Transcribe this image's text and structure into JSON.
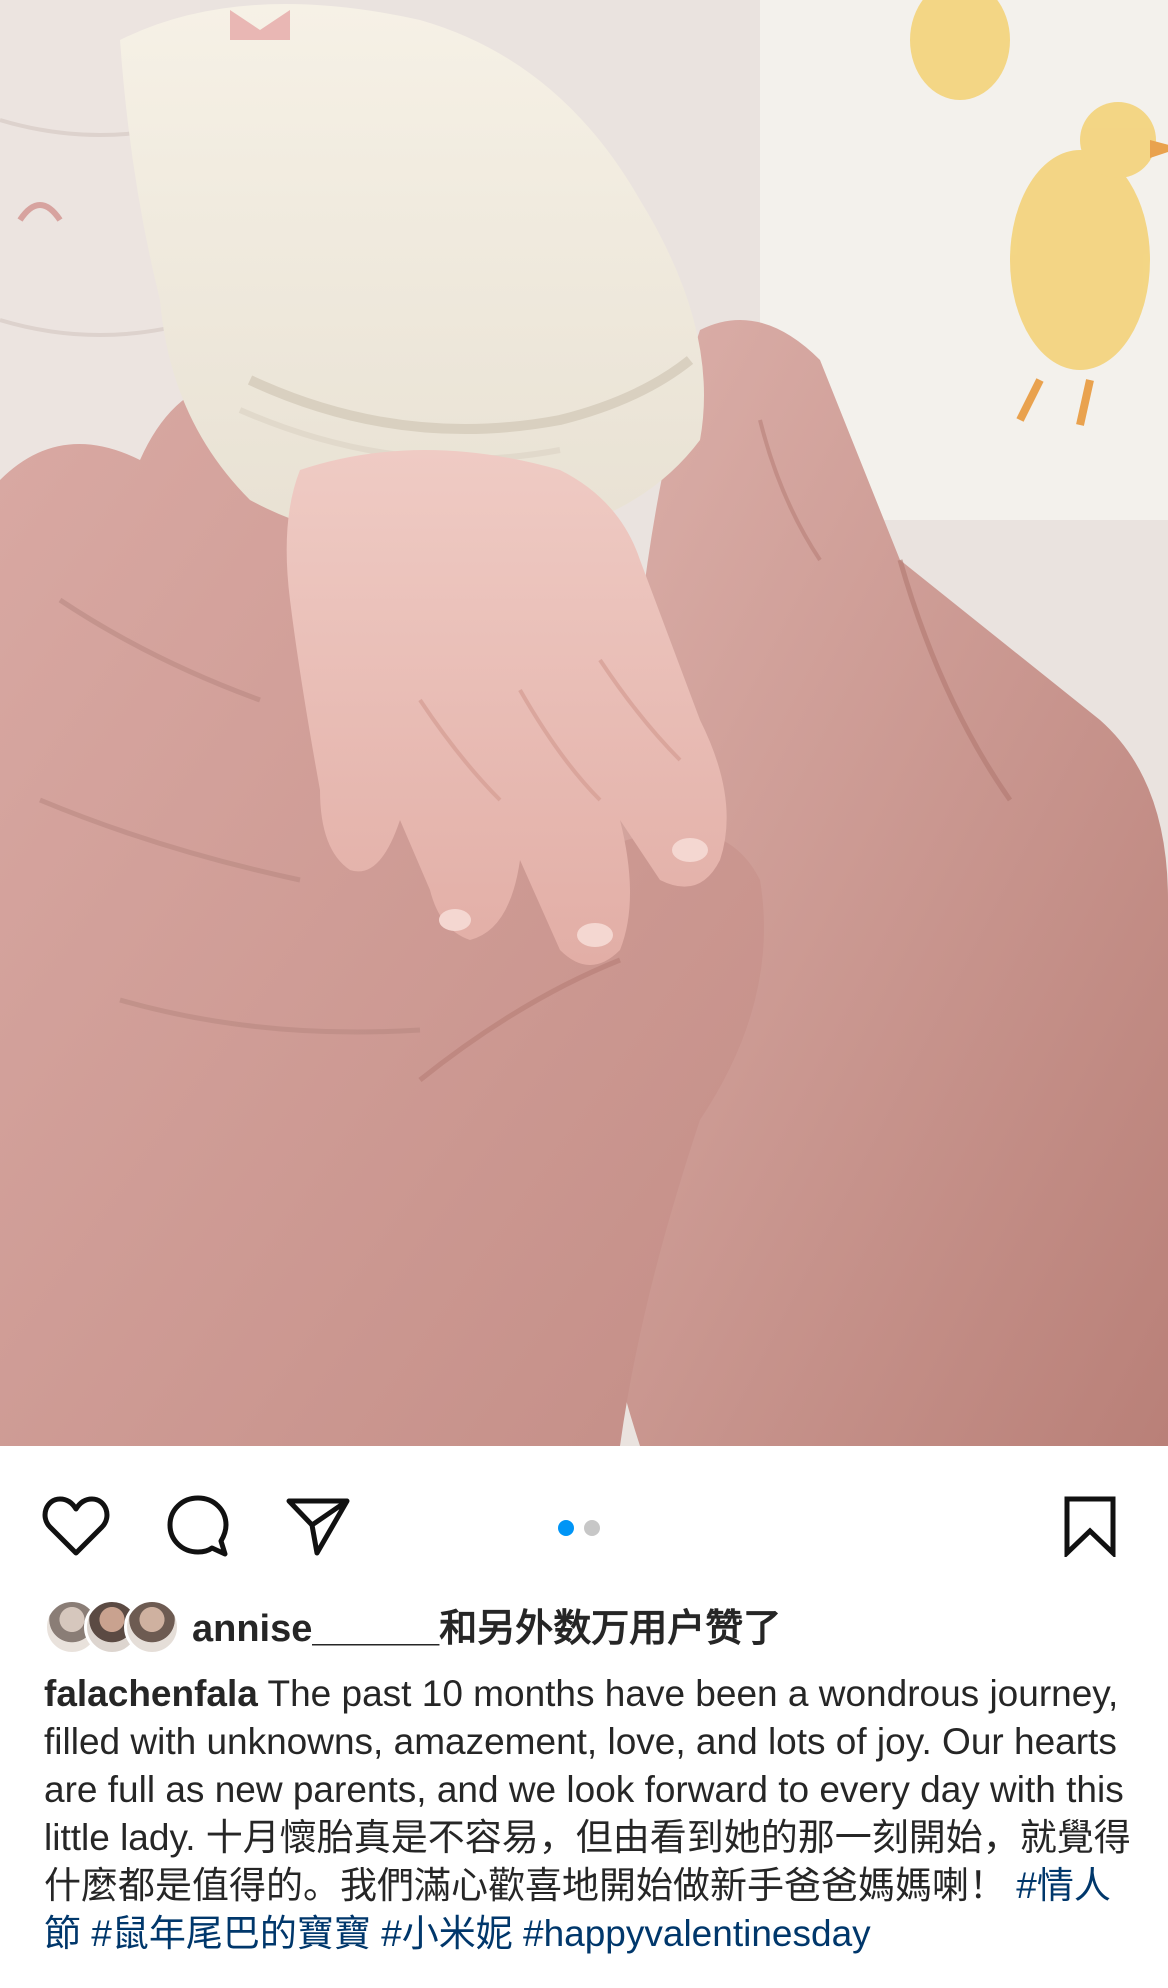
{
  "post": {
    "photo_alt": "",
    "actions": {
      "like_icon": "heart-icon",
      "comment_icon": "comment-icon",
      "share_icon": "share-icon",
      "save_icon": "bookmark-icon"
    },
    "carousel": {
      "total": 2,
      "active": 1
    },
    "likes": {
      "username": "annise______",
      "rest": "和另外数万用户赞了"
    },
    "caption": {
      "username": "falachenfala",
      "text": " The past 10 months have been a wondrous journey, filled with unknowns, amazement, love, and lots of joy. Our hearts are full as new parents, and we look forward to every day with this little lady. 十月懷胎真是不容易，但由看到她的那一刻開始，就覺得什麼都是值得的。我們滿心歡喜地開始做新手爸爸媽媽喇！",
      "hashtags": "#情人節 #鼠年尾巴的寶寶 #小米妮 #happyvalentinesday"
    },
    "colors": {
      "accent": "#0095f6",
      "text": "#262626",
      "hashtag": "#00376b"
    }
  }
}
